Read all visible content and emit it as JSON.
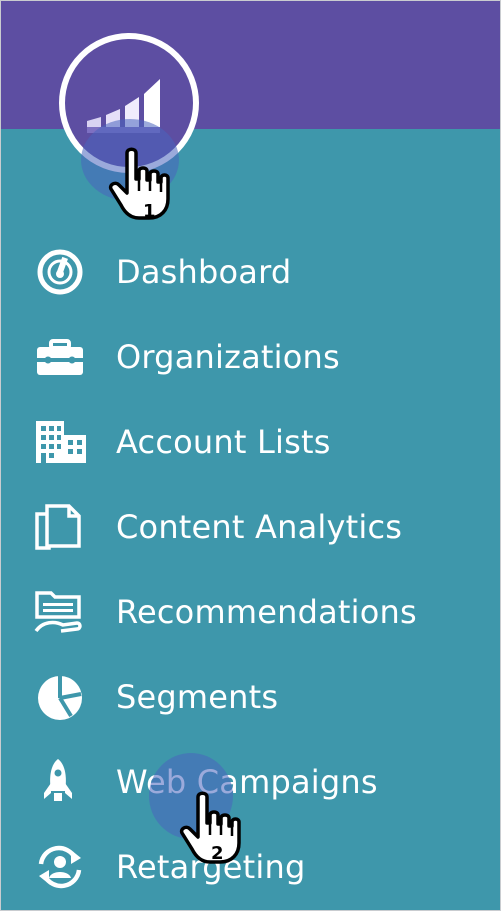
{
  "app": {
    "logo_icon": "marketo-bars-logo-icon",
    "colors": {
      "header": "#5d4ea2",
      "sidebar": "#3e97ab",
      "text": "#ffffff",
      "ripple": "#4864be"
    }
  },
  "nav": {
    "items": [
      {
        "label": "Dashboard",
        "icon": "gauge-icon"
      },
      {
        "label": "Organizations",
        "icon": "briefcase-icon"
      },
      {
        "label": "Account Lists",
        "icon": "buildings-icon"
      },
      {
        "label": "Content Analytics",
        "icon": "documents-icon"
      },
      {
        "label": "Recommendations",
        "icon": "folder-hand-icon"
      },
      {
        "label": "Segments",
        "icon": "pie-chart-icon"
      },
      {
        "label": "Web Campaigns",
        "icon": "rocket-icon"
      },
      {
        "label": "Retargeting",
        "icon": "retarget-person-icon"
      }
    ]
  },
  "annotations": {
    "step1": "1",
    "step2": "2"
  }
}
